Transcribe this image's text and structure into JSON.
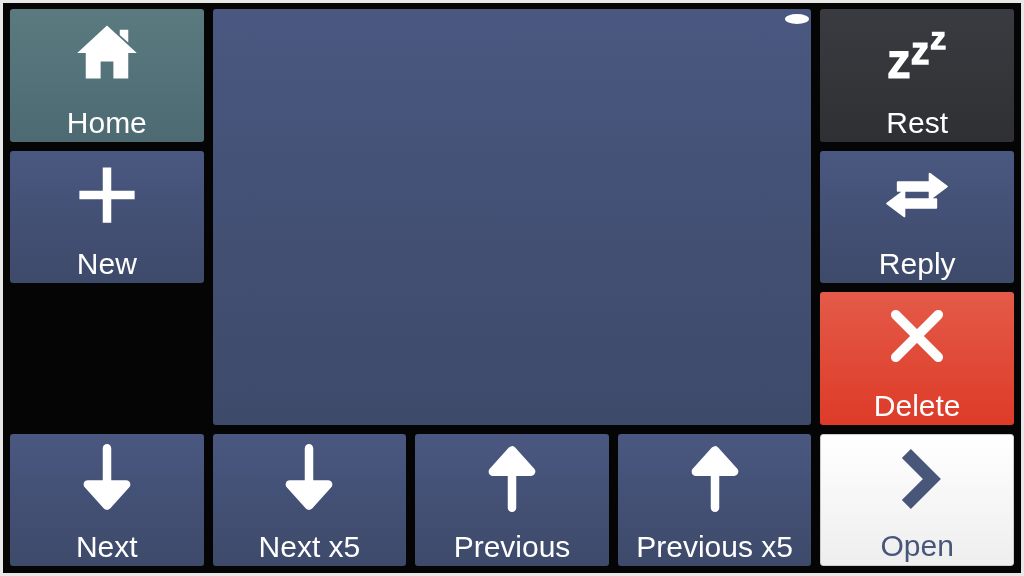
{
  "buttons": [
    {
      "label": "Home",
      "kind": "home"
    },
    {
      "label": "Rest",
      "kind": "idle"
    },
    {
      "label": "New",
      "kind": "standard"
    },
    {
      "label": "Reply",
      "kind": "standard"
    },
    {
      "label": "Delete",
      "kind": "destructive"
    },
    {
      "label": "Next",
      "kind": "standard"
    },
    {
      "label": "Next x5",
      "kind": "standard"
    },
    {
      "label": "Previous",
      "kind": "standard"
    },
    {
      "label": "Previous x5",
      "kind": "standard"
    },
    {
      "label": "Open",
      "kind": "primary"
    }
  ]
}
